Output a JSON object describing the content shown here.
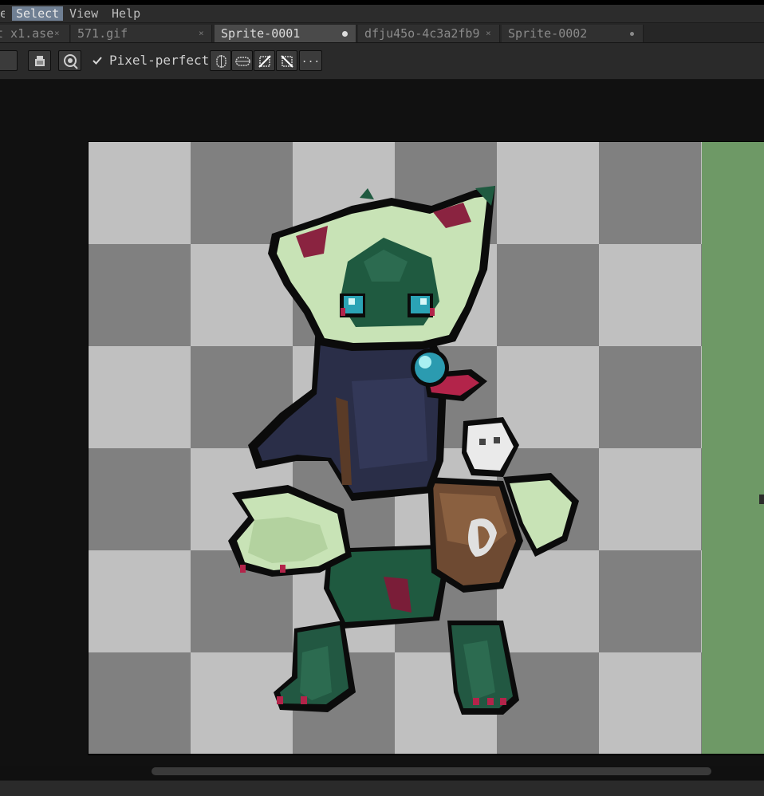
{
  "menubar": {
    "partial_item": "e",
    "items": [
      "Select",
      "View",
      "Help"
    ]
  },
  "tabs": [
    {
      "label": "t x1.ase",
      "close": "×"
    },
    {
      "label": "571.gif",
      "close": "×"
    },
    {
      "label": "Sprite-0001",
      "modified": true
    },
    {
      "label": "dfju45o-4c3a2fb9",
      "close": "×"
    },
    {
      "label": "Sprite-0002",
      "modified": true
    }
  ],
  "toolbar": {
    "pixel_perfect_label": "Pixel-perfect",
    "pixel_perfect_checked": true,
    "more_label": "..."
  },
  "icons": {
    "ink": "ink-icon",
    "eyedropper": "eyedropper-icon",
    "checkbox": "check-icon",
    "symmetry": "symmetry-icon",
    "more": "more-options-icon"
  },
  "colors": {
    "menu_active": "#6f7f93",
    "canvas_bg": "#111111",
    "checker_dark": "#808080",
    "checker_light": "#c0c0c0",
    "sprite_bg_green": "#6e9966"
  }
}
